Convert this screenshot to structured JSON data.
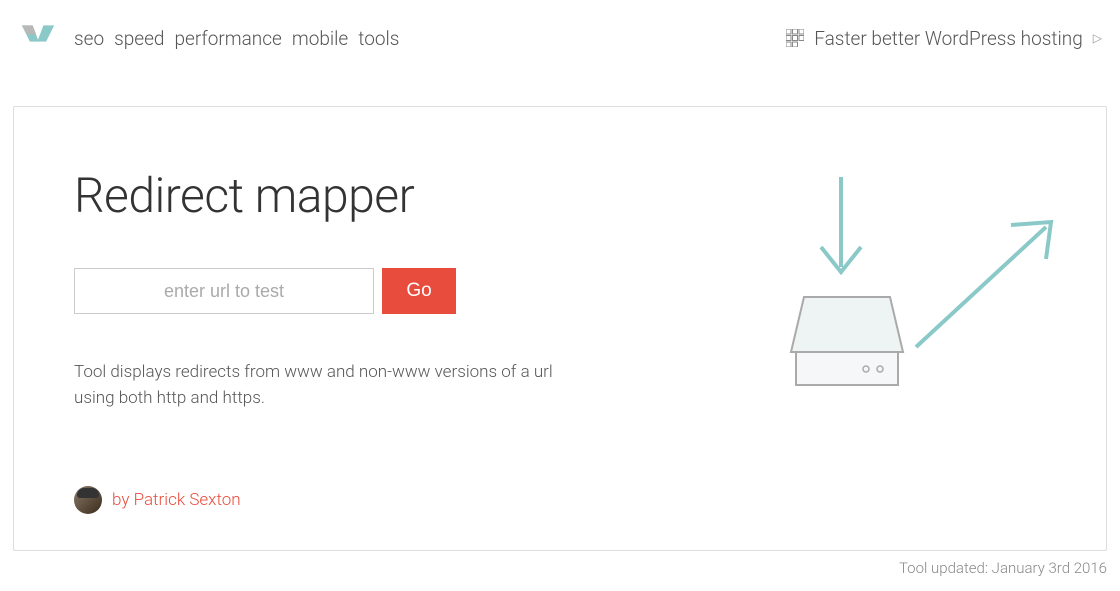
{
  "nav": {
    "items": [
      "seo",
      "speed",
      "performance",
      "mobile",
      "tools"
    ]
  },
  "promo": {
    "text": "Faster better WordPress hosting",
    "arrow": "▷"
  },
  "main": {
    "title": "Redirect mapper",
    "input_placeholder": "enter url to test",
    "button_label": "Go",
    "description": "Tool displays redirects from www and non-www versions of a url using both http and https."
  },
  "author": {
    "text": "by Patrick Sexton"
  },
  "footer": {
    "updated": "Tool updated: January 3rd 2016"
  },
  "colors": {
    "accent_teal": "#8bc9c9",
    "accent_red": "#e74c3c"
  }
}
